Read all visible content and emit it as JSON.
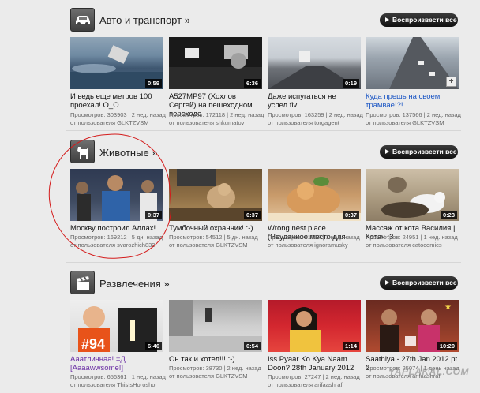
{
  "play_all_label": "Воспроизвести все",
  "watermark": "YAPLAKAL.COM",
  "sections": [
    {
      "title": "Авто и транспорт »",
      "icon": "car-icon",
      "videos": [
        {
          "title": "И ведь еще метров 100 проехал! О_О",
          "duration": "0:59",
          "meta1": "Просмотров: 303903 | 2 нед. назад",
          "meta2": "от пользователя GLKTZVSM",
          "title_color": "#111111"
        },
        {
          "title": "А527МР97 (Хохлов Сергей) на пешеходном переходе",
          "duration": "6:36",
          "meta1": "Просмотров: 172118 | 2 нед. назад",
          "meta2": "от пользователя shkumatov",
          "title_color": "#111111"
        },
        {
          "title": "Даже испугаться не успел.flv",
          "duration": "0:19",
          "meta1": "Просмотров: 163259 | 2 нед. назад",
          "meta2": "от пользователя torgagent",
          "title_color": "#111111"
        },
        {
          "title": "Куда прешь на своем трамвае!?!",
          "duration": "",
          "meta1": "Просмотров: 137566 | 2 нед. назад",
          "meta2": "от пользователя GLKTZVSM",
          "title_color": "#1b56c4"
        }
      ]
    },
    {
      "title": "Животные »",
      "icon": "dog-icon",
      "videos": [
        {
          "title": "Москву построил Аллах!",
          "duration": "0:37",
          "meta1": "Просмотров: 169212 | 5 дн. назад",
          "meta2": "от пользователя svarozhich832",
          "title_color": "#111111"
        },
        {
          "title": "Тумбочный охранник! :-)",
          "duration": "0:37",
          "meta1": "Просмотров: 54512 | 5 дн. назад",
          "meta2": "от пользователя GLKTZVSM",
          "title_color": "#111111"
        },
        {
          "title": "Wrong nest place (Неудачное место для",
          "duration": "0:37",
          "meta1": "Просмотров: 51637 | 1 нед. назад",
          "meta2": "от пользователя ignoramusky",
          "title_color": "#111111"
        },
        {
          "title": "Массаж от кота Василия | Котач :3",
          "duration": "0:23",
          "meta1": "Просмотров: 24951 | 1 нед. назад",
          "meta2": "от пользователя catocomics",
          "title_color": "#111111"
        }
      ]
    },
    {
      "title": "Развлечения »",
      "icon": "clapperboard-icon",
      "videos": [
        {
          "title": "Ааатличнаа! =Д [Aaaawwsome!]",
          "duration": "6:46",
          "meta1": "Просмотров: 656361 | 1 нед. назад",
          "meta2": "от пользователя ThisIsHorosho",
          "title_color": "#6b2fa5"
        },
        {
          "title": "Он так и хотел!!! :-)",
          "duration": "0:54",
          "meta1": "Просмотров: 38730 | 2 нед. назад",
          "meta2": "от пользователя GLKTZVSM",
          "title_color": "#111111"
        },
        {
          "title": "Iss Pyaar Ko Kya Naam Doon? 28th January 2012",
          "duration": "1:14",
          "meta1": "Просмотров: 27247 | 2 нед. назад",
          "meta2": "от пользователя arifaashrafi",
          "title_color": "#111111"
        },
        {
          "title": "Saathiya - 27th Jan 2012 pt 2",
          "duration": "10:20",
          "meta1": "Просмотров: 25074 | 1 день назад",
          "meta2": "от пользователя arifaashrafi",
          "title_color": "#111111"
        }
      ]
    }
  ]
}
